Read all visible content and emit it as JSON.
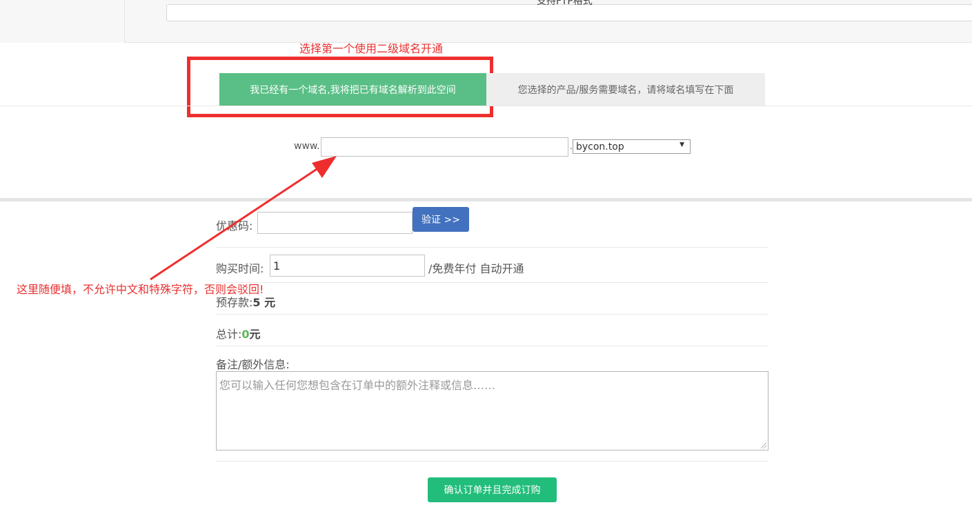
{
  "top": {
    "header_text": "支持FTP格式"
  },
  "annotations": {
    "tab_hint": "选择第一个使用二级域名开通",
    "input_hint": "这里随便填，不允许中文和特殊字符，否则会驳回!",
    "color": "#e8302f"
  },
  "tabs": {
    "active": "我已经有一个域名,我将把已有域名解析到此空间",
    "inactive": "您选择的产品/服务需要域名，请将域名填写在下面"
  },
  "domain": {
    "prefix": "www.",
    "input_value": "",
    "dot": ".",
    "selected_suffix": "bycon.top"
  },
  "form": {
    "coupon_label": "优惠码:",
    "verify_button": "验证 >>",
    "duration_label": "购买时间:",
    "duration_value": "1",
    "duration_suffix": "/免费年付 自动开通",
    "deposit_label": "预存款:",
    "deposit_value": "5 元",
    "total_label": "总计:",
    "total_amount": "0",
    "total_unit": "元",
    "notes_label": "备注/额外信息:",
    "notes_placeholder": "您可以输入任何您想包含在订单中的额外注释或信息……",
    "submit_button": "确认订单并且完成订购"
  },
  "colors": {
    "tab_active": "#5abf86",
    "verify_button": "#4271bf",
    "submit_button": "#22bd7b",
    "total_green": "#5cb85c"
  }
}
